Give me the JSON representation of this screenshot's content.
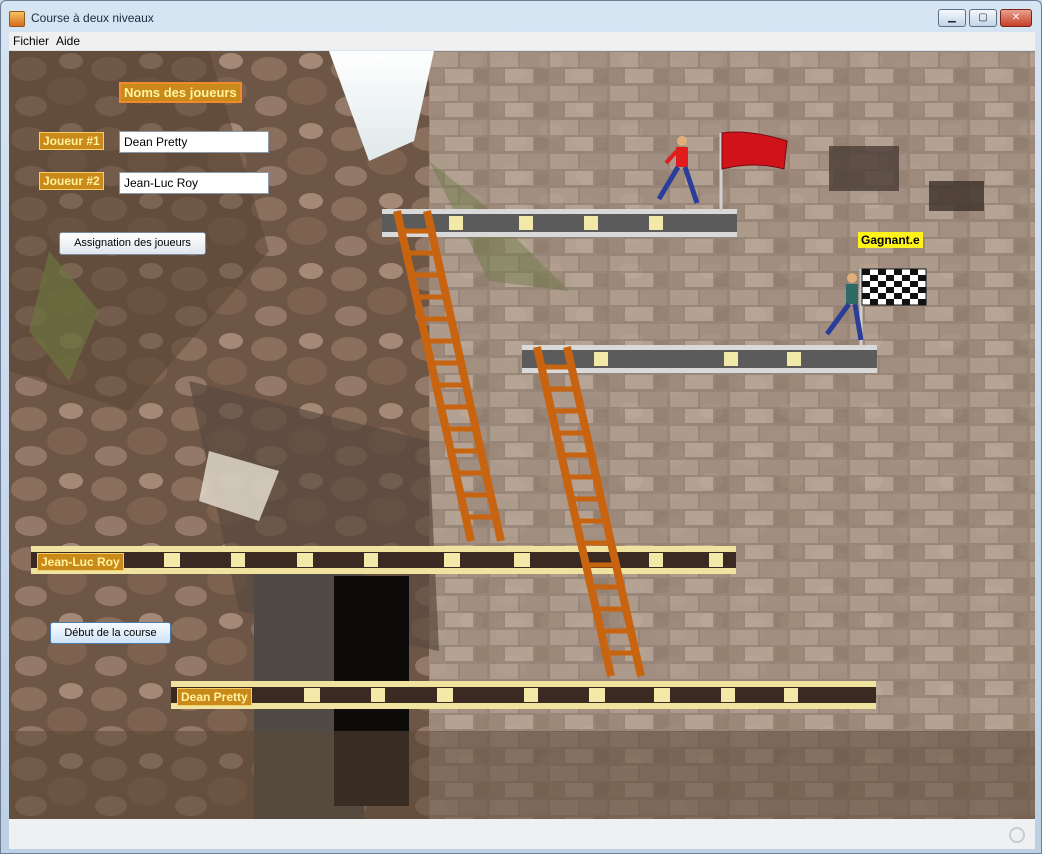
{
  "window": {
    "title": "Course à deux niveaux",
    "minimize": "▁",
    "maximize": "▢",
    "close": "✕"
  },
  "menu": {
    "items": [
      "Fichier",
      "Aide"
    ]
  },
  "panel": {
    "header": "Noms des joueurs",
    "player1_label": "Joueur #1",
    "player1_value": "Dean Pretty",
    "player2_label": "Joueur #2",
    "player2_value": "Jean-Luc Roy",
    "assign_button": "Assignation des joueurs",
    "start_button": "Début de la course"
  },
  "track": {
    "lane2_name": "Jean-Luc Roy",
    "lane1_name": "Dean Pretty",
    "winner_label": "Gagnant.e"
  },
  "colors": {
    "label_bg": "#c98a1a",
    "label_fg": "#fff3a0",
    "winner_bg": "#fff31a",
    "ladder": "#c86410",
    "flag_red": "#d0121a"
  }
}
